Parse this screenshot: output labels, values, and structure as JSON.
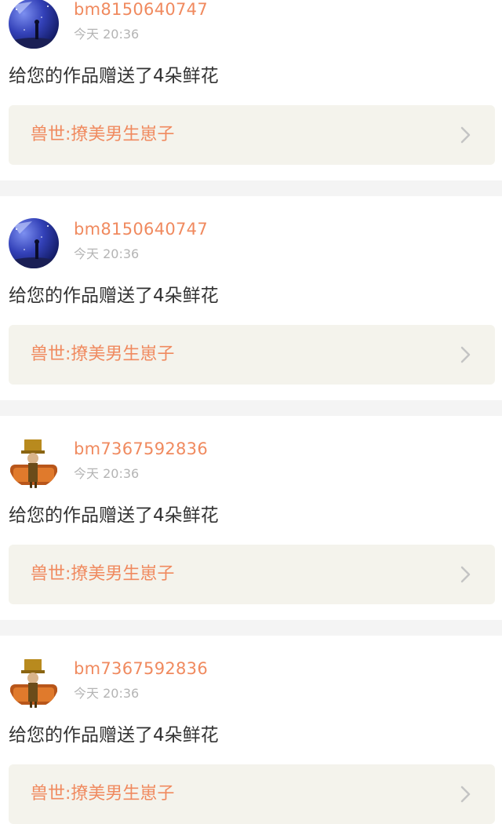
{
  "colors": {
    "accent": "#f08a5f",
    "text": "#333333",
    "muted": "#b4b4b4",
    "link_bg": "#f4f3ec",
    "divider": "#f4f4f4"
  },
  "notifications": [
    {
      "avatar_icon": "anime-starry-sky-icon",
      "username": "bm8150640747",
      "time": "今天 20:36",
      "message": "给您的作品赠送了4朵鲜花",
      "work_title": "兽世:撩美男生崽子",
      "chevron_icon": "chevron-right-icon"
    },
    {
      "avatar_icon": "anime-starry-sky-icon",
      "username": "bm8150640747",
      "time": "今天 20:36",
      "message": "给您的作品赠送了4朵鲜花",
      "work_title": "兽世:撩美男生崽子",
      "chevron_icon": "chevron-right-icon"
    },
    {
      "avatar_icon": "steampunk-character-icon",
      "username": "bm7367592836",
      "time": "今天 20:36",
      "message": "给您的作品赠送了4朵鲜花",
      "work_title": "兽世:撩美男生崽子",
      "chevron_icon": "chevron-right-icon"
    },
    {
      "avatar_icon": "steampunk-character-icon",
      "username": "bm7367592836",
      "time": "今天 20:36",
      "message": "给您的作品赠送了4朵鲜花",
      "work_title": "兽世:撩美男生崽子",
      "chevron_icon": "chevron-right-icon"
    }
  ]
}
